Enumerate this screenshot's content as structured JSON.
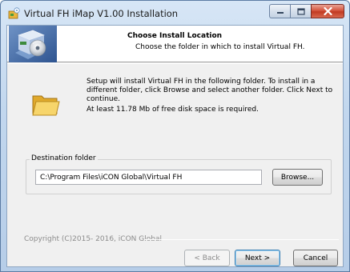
{
  "window": {
    "title": "Virtual FH iMap V1.00 Installation",
    "controls": {
      "minimize": "minimize",
      "maximize": "maximize",
      "close": "close"
    }
  },
  "header": {
    "title": "Choose Install Location",
    "subtitle": "Choose the folder in which to install Virtual FH."
  },
  "body": {
    "description": "Setup will install Virtual FH in the following folder. To install in a different folder, click Browse and select another folder. Click Next to continue.",
    "space_required": "At least 11.78 Mb of free disk space is required."
  },
  "destination": {
    "label": "Destination folder",
    "path": "C:\\Program Files\\iCON Global\\Virtual FH",
    "browse_label": "Browse..."
  },
  "footer": {
    "branding": "Copyright (C)2015- 2016, iCON Global",
    "back_label": "< Back",
    "next_label": "Next >",
    "cancel_label": "Cancel"
  },
  "icons": {
    "app": "installer-app-icon",
    "header": "cd-installer-icon",
    "folder": "folder-icon"
  },
  "colors": {
    "title_bar": "#c2d7ee",
    "close_button": "#c13a22",
    "dialog_face": "#f0f0f0",
    "folder": "#f2c94c"
  }
}
